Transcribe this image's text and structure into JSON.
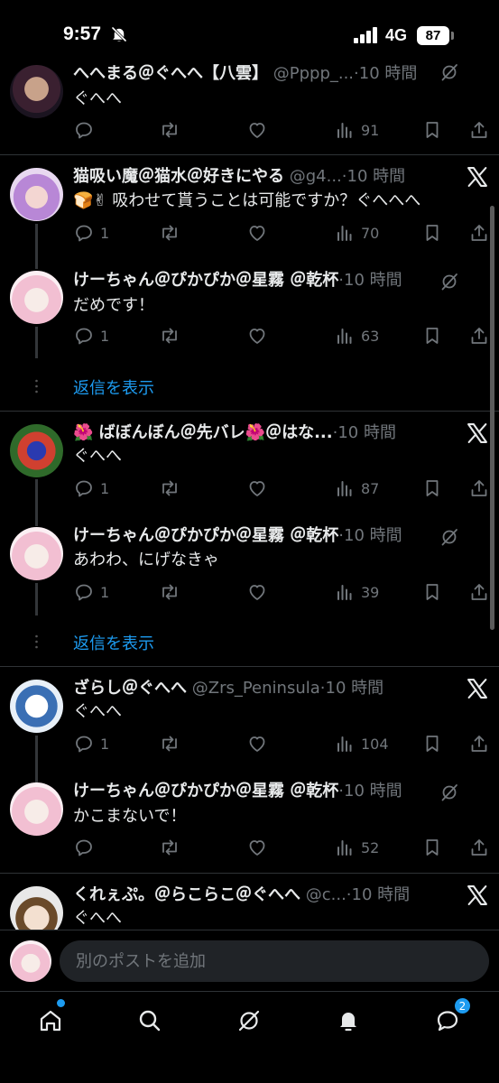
{
  "status": {
    "time": "9:57",
    "network": "4G",
    "battery": "87"
  },
  "tweets": [
    {
      "name": "へへまる＠ぐへへ【八雲】",
      "handle": "@Pppp_...",
      "time": "·10 時間",
      "text": "ぐへへ",
      "replies": "",
      "views": "91"
    },
    {
      "name": "猫吸い魔＠猫水＠好きにやる",
      "handle": "@g4...",
      "time": "·10 時間",
      "text": "🍞✌ 吸わせて貰うことは可能ですか？ぐへへへ",
      "replies": "1",
      "views": "70"
    },
    {
      "name": "けーちゃん＠ぴかぴか＠星霧 ＠乾杯",
      "handle": "",
      "time": "·10 時間",
      "text": "だめです！",
      "replies": "1",
      "views": "63"
    },
    {
      "name": "🌺 ばぼんぼん＠先バレ🌺＠はな...",
      "handle": "",
      "time": "·10 時間",
      "text": "ぐへへ",
      "replies": "1",
      "views": "87"
    },
    {
      "name": "けーちゃん＠ぴかぴか＠星霧 ＠乾杯",
      "handle": "",
      "time": "·10 時間",
      "text": "あわわ、にげなきゃ",
      "replies": "1",
      "views": "39"
    },
    {
      "name": "ざらし＠ぐへへ",
      "handle": "@Zrs_Peninsula",
      "time": "·10 時間",
      "text": "ぐへへ",
      "replies": "1",
      "views": "104"
    },
    {
      "name": "けーちゃん＠ぴかぴか＠星霧 ＠乾杯",
      "handle": "",
      "time": "·10 時間",
      "text": "かこまないで！",
      "replies": "",
      "views": "52"
    },
    {
      "name": "くれぇぷ。＠らこらこ＠ぐへへ",
      "handle": "@c...",
      "time": "·10 時間",
      "text": "ぐへへ",
      "replies": "",
      "views": ""
    }
  ],
  "show_replies_label": "返信を表示",
  "composer": {
    "placeholder": "別のポストを追加"
  },
  "tabbar": {
    "messages_badge": "2"
  },
  "colors": {
    "accent": "#1d9bf0",
    "muted": "#71767b",
    "background": "#000000"
  },
  "icons": [
    "x-logo-icon",
    "grok-icon",
    "reply-icon",
    "repost-icon",
    "like-icon",
    "views-icon",
    "bookmark-icon",
    "share-icon",
    "home-icon",
    "search-icon",
    "bell-icon",
    "messages-icon"
  ]
}
